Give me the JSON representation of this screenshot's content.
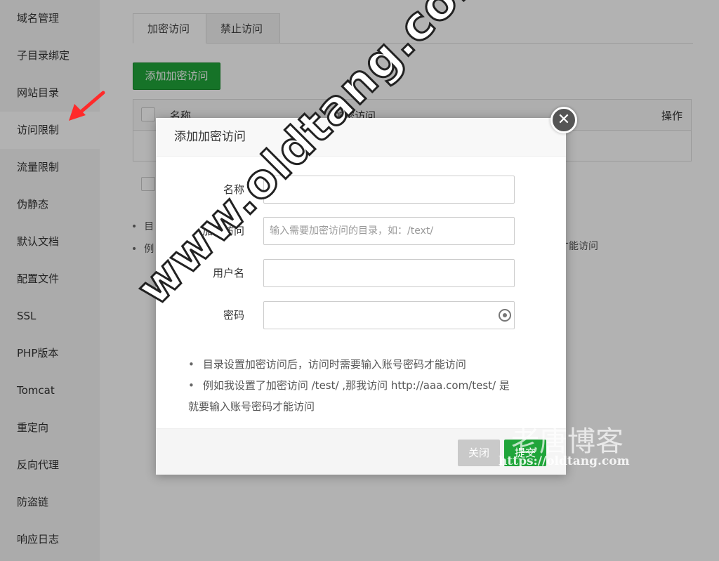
{
  "sidebar": {
    "items": [
      {
        "label": "域名管理"
      },
      {
        "label": "子目录绑定"
      },
      {
        "label": "网站目录"
      },
      {
        "label": "访问限制"
      },
      {
        "label": "流量限制"
      },
      {
        "label": "伪静态"
      },
      {
        "label": "默认文档"
      },
      {
        "label": "配置文件"
      },
      {
        "label": "SSL"
      },
      {
        "label": "PHP版本"
      },
      {
        "label": "Tomcat"
      },
      {
        "label": "重定向"
      },
      {
        "label": "反向代理"
      },
      {
        "label": "防盗链"
      },
      {
        "label": "响应日志"
      }
    ],
    "active_index": 3
  },
  "main": {
    "tabs": [
      {
        "label": "加密访问"
      },
      {
        "label": "禁止访问"
      }
    ],
    "add_button": "添加加密访问",
    "table": {
      "headers": [
        "名称",
        "加密访问",
        "操作"
      ]
    },
    "notes": [
      "目",
      "例"
    ],
    "notes_tail": "才能访问"
  },
  "modal": {
    "title": "添加加密访问",
    "close_icon": "close-icon",
    "fields": [
      {
        "label": "名称",
        "value": "",
        "placeholder": ""
      },
      {
        "label": "加密访问",
        "value": "",
        "placeholder": "输入需要加密访问的目录，如：/text/"
      },
      {
        "label": "用户名",
        "value": "",
        "placeholder": ""
      },
      {
        "label": "密码",
        "value": "",
        "placeholder": ""
      }
    ],
    "notes": [
      "目录设置加密访问后，访问时需要输入账号密码才能访问",
      "例如我设置了加密访问 /test/ ,那我访问 http://aaa.com/test/ 是",
      "就要输入账号密码才能访问"
    ],
    "cancel_button": "关闭",
    "submit_button": "提交"
  },
  "watermark": {
    "big": "www.oldtang.com",
    "cn": "老唐博客",
    "url": "https://oldtang.com"
  },
  "colors": {
    "accent": "#20a53a",
    "annotation_arrow": "#ff2a2a"
  }
}
